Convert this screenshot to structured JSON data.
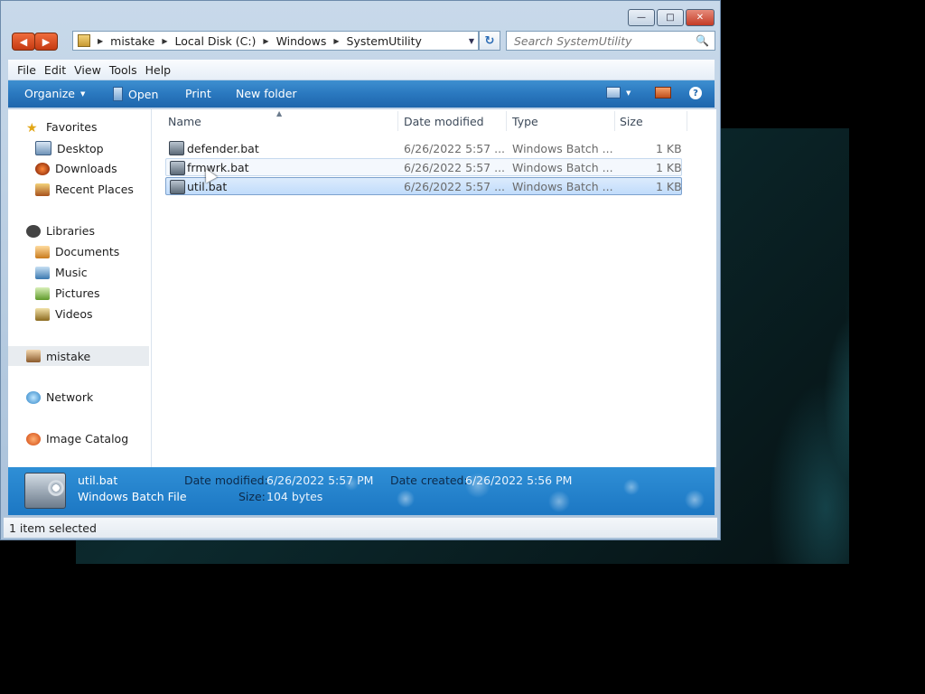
{
  "window": {
    "caption_buttons": [
      "minimize",
      "maximize",
      "close"
    ]
  },
  "address": {
    "segments": [
      "mistake",
      "Local Disk (C:)",
      "Windows",
      "SystemUtility"
    ]
  },
  "search": {
    "placeholder": "Search SystemUtility"
  },
  "menu": {
    "items": [
      "File",
      "Edit",
      "View",
      "Tools",
      "Help"
    ]
  },
  "toolbar": {
    "organize": "Organize",
    "open": "Open",
    "print": "Print",
    "new_folder": "New folder"
  },
  "sidebar": {
    "favorites": "Favorites",
    "desktop": "Desktop",
    "downloads": "Downloads",
    "recent": "Recent Places",
    "libraries": "Libraries",
    "documents": "Documents",
    "music": "Music",
    "pictures": "Pictures",
    "videos": "Videos",
    "user": "mistake",
    "network": "Network",
    "image_catalog": "Image Catalog"
  },
  "columns": {
    "name": "Name",
    "date": "Date modified",
    "type": "Type",
    "size": "Size"
  },
  "files": [
    {
      "name": "defender.bat",
      "date": "6/26/2022 5:57 ...",
      "type": "Windows Batch ...",
      "size": "1 KB"
    },
    {
      "name": "frmwrk.bat",
      "date": "6/26/2022 5:57 ...",
      "type": "Windows Batch ...",
      "size": "1 KB"
    },
    {
      "name": "util.bat",
      "date": "6/26/2022 5:57 ...",
      "type": "Windows Batch ...",
      "size": "1 KB"
    }
  ],
  "details": {
    "name": "util.bat",
    "kind": "Windows Batch File",
    "modified_label": "Date modified:",
    "modified_value": "6/26/2022 5:57 PM",
    "created_label": "Date created:",
    "created_value": "6/26/2022 5:56 PM",
    "size_label": "Size:",
    "size_value": "104 bytes"
  },
  "status": {
    "text": "1 item selected"
  }
}
